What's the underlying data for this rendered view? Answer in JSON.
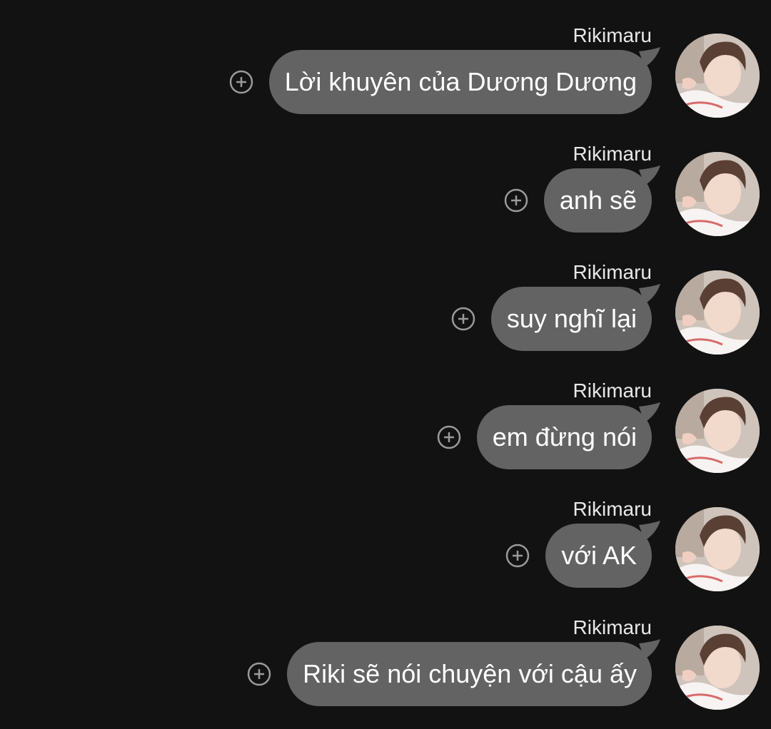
{
  "messages": [
    {
      "sender": "Rikimaru",
      "text": "Lời khuyên của Dương Dương"
    },
    {
      "sender": "Rikimaru",
      "text": "anh sẽ"
    },
    {
      "sender": "Rikimaru",
      "text": "suy nghĩ lại"
    },
    {
      "sender": "Rikimaru",
      "text": "em đừng nói"
    },
    {
      "sender": "Rikimaru",
      "text": "với AK"
    },
    {
      "sender": "Rikimaru",
      "text": "Riki sẽ nói chuyện với cậu ấy"
    }
  ],
  "icons": {
    "add": "add-circle-icon",
    "avatar": "avatar"
  },
  "colors": {
    "background": "#121212",
    "bubble": "#636363",
    "text": "#ffffff",
    "sender": "#e8e8e8",
    "icon": "#9a9a9a"
  }
}
